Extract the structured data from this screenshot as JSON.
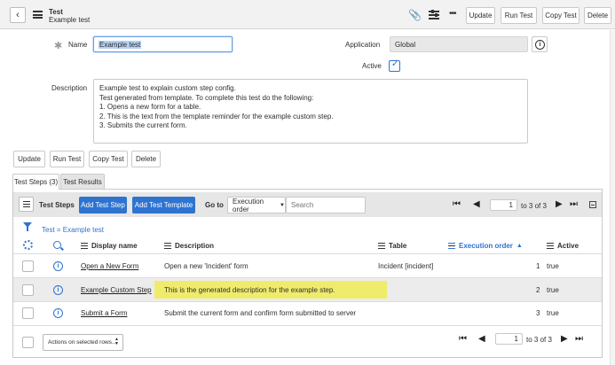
{
  "header": {
    "title": "Test",
    "subtitle": "Example test",
    "buttons": [
      "Update",
      "Run Test",
      "Copy Test",
      "Delete"
    ]
  },
  "form": {
    "name_label": "Name",
    "name_value": "Example test",
    "application_label": "Application",
    "application_value": "Global",
    "active_label": "Active",
    "description_label": "Description",
    "description_lines": [
      "Example test to explain custom step config.",
      "Test generated from template. To complete this test do the following:",
      "1. Opens a new form for a table.",
      "2. This is the text from the template reminder for the example custom step.",
      "3. Submits the current form."
    ]
  },
  "actions": [
    "Update",
    "Run Test",
    "Copy Test",
    "Delete"
  ],
  "tabs": [
    "Test Steps (3)",
    "Test Results"
  ],
  "list": {
    "title": "Test Steps",
    "add_step": "Add Test Step",
    "add_template": "Add Test Template",
    "go_to": "Go to",
    "search_field": "Execution order",
    "search_placeholder": "Search",
    "page_number": "1",
    "page_of": "to 3 of 3",
    "filter": "Test = Example test",
    "columns": {
      "display_name": "Display name",
      "description": "Description",
      "table": "Table",
      "execution_order": "Execution order",
      "active": "Active"
    },
    "rows": [
      {
        "name": "Open a New Form",
        "description": "Open a new 'Incident' form",
        "table": "Incident [incident]",
        "order": "1",
        "active": "true"
      },
      {
        "name": "Example Custom Step",
        "description": "This is the generated description for the example step.",
        "table": "",
        "order": "2",
        "active": "true"
      },
      {
        "name": "Submit a Form",
        "description": "Submit the current form and confirm form submitted to server",
        "table": "",
        "order": "3",
        "active": "true"
      }
    ],
    "bulk_action": "Actions on selected rows...",
    "footer_page": "1",
    "footer_of": "to 3 of 3"
  },
  "colors": {
    "accent": "#2f73d0",
    "highlight": "#efec6c",
    "header_bg": "#f2f2f2"
  }
}
